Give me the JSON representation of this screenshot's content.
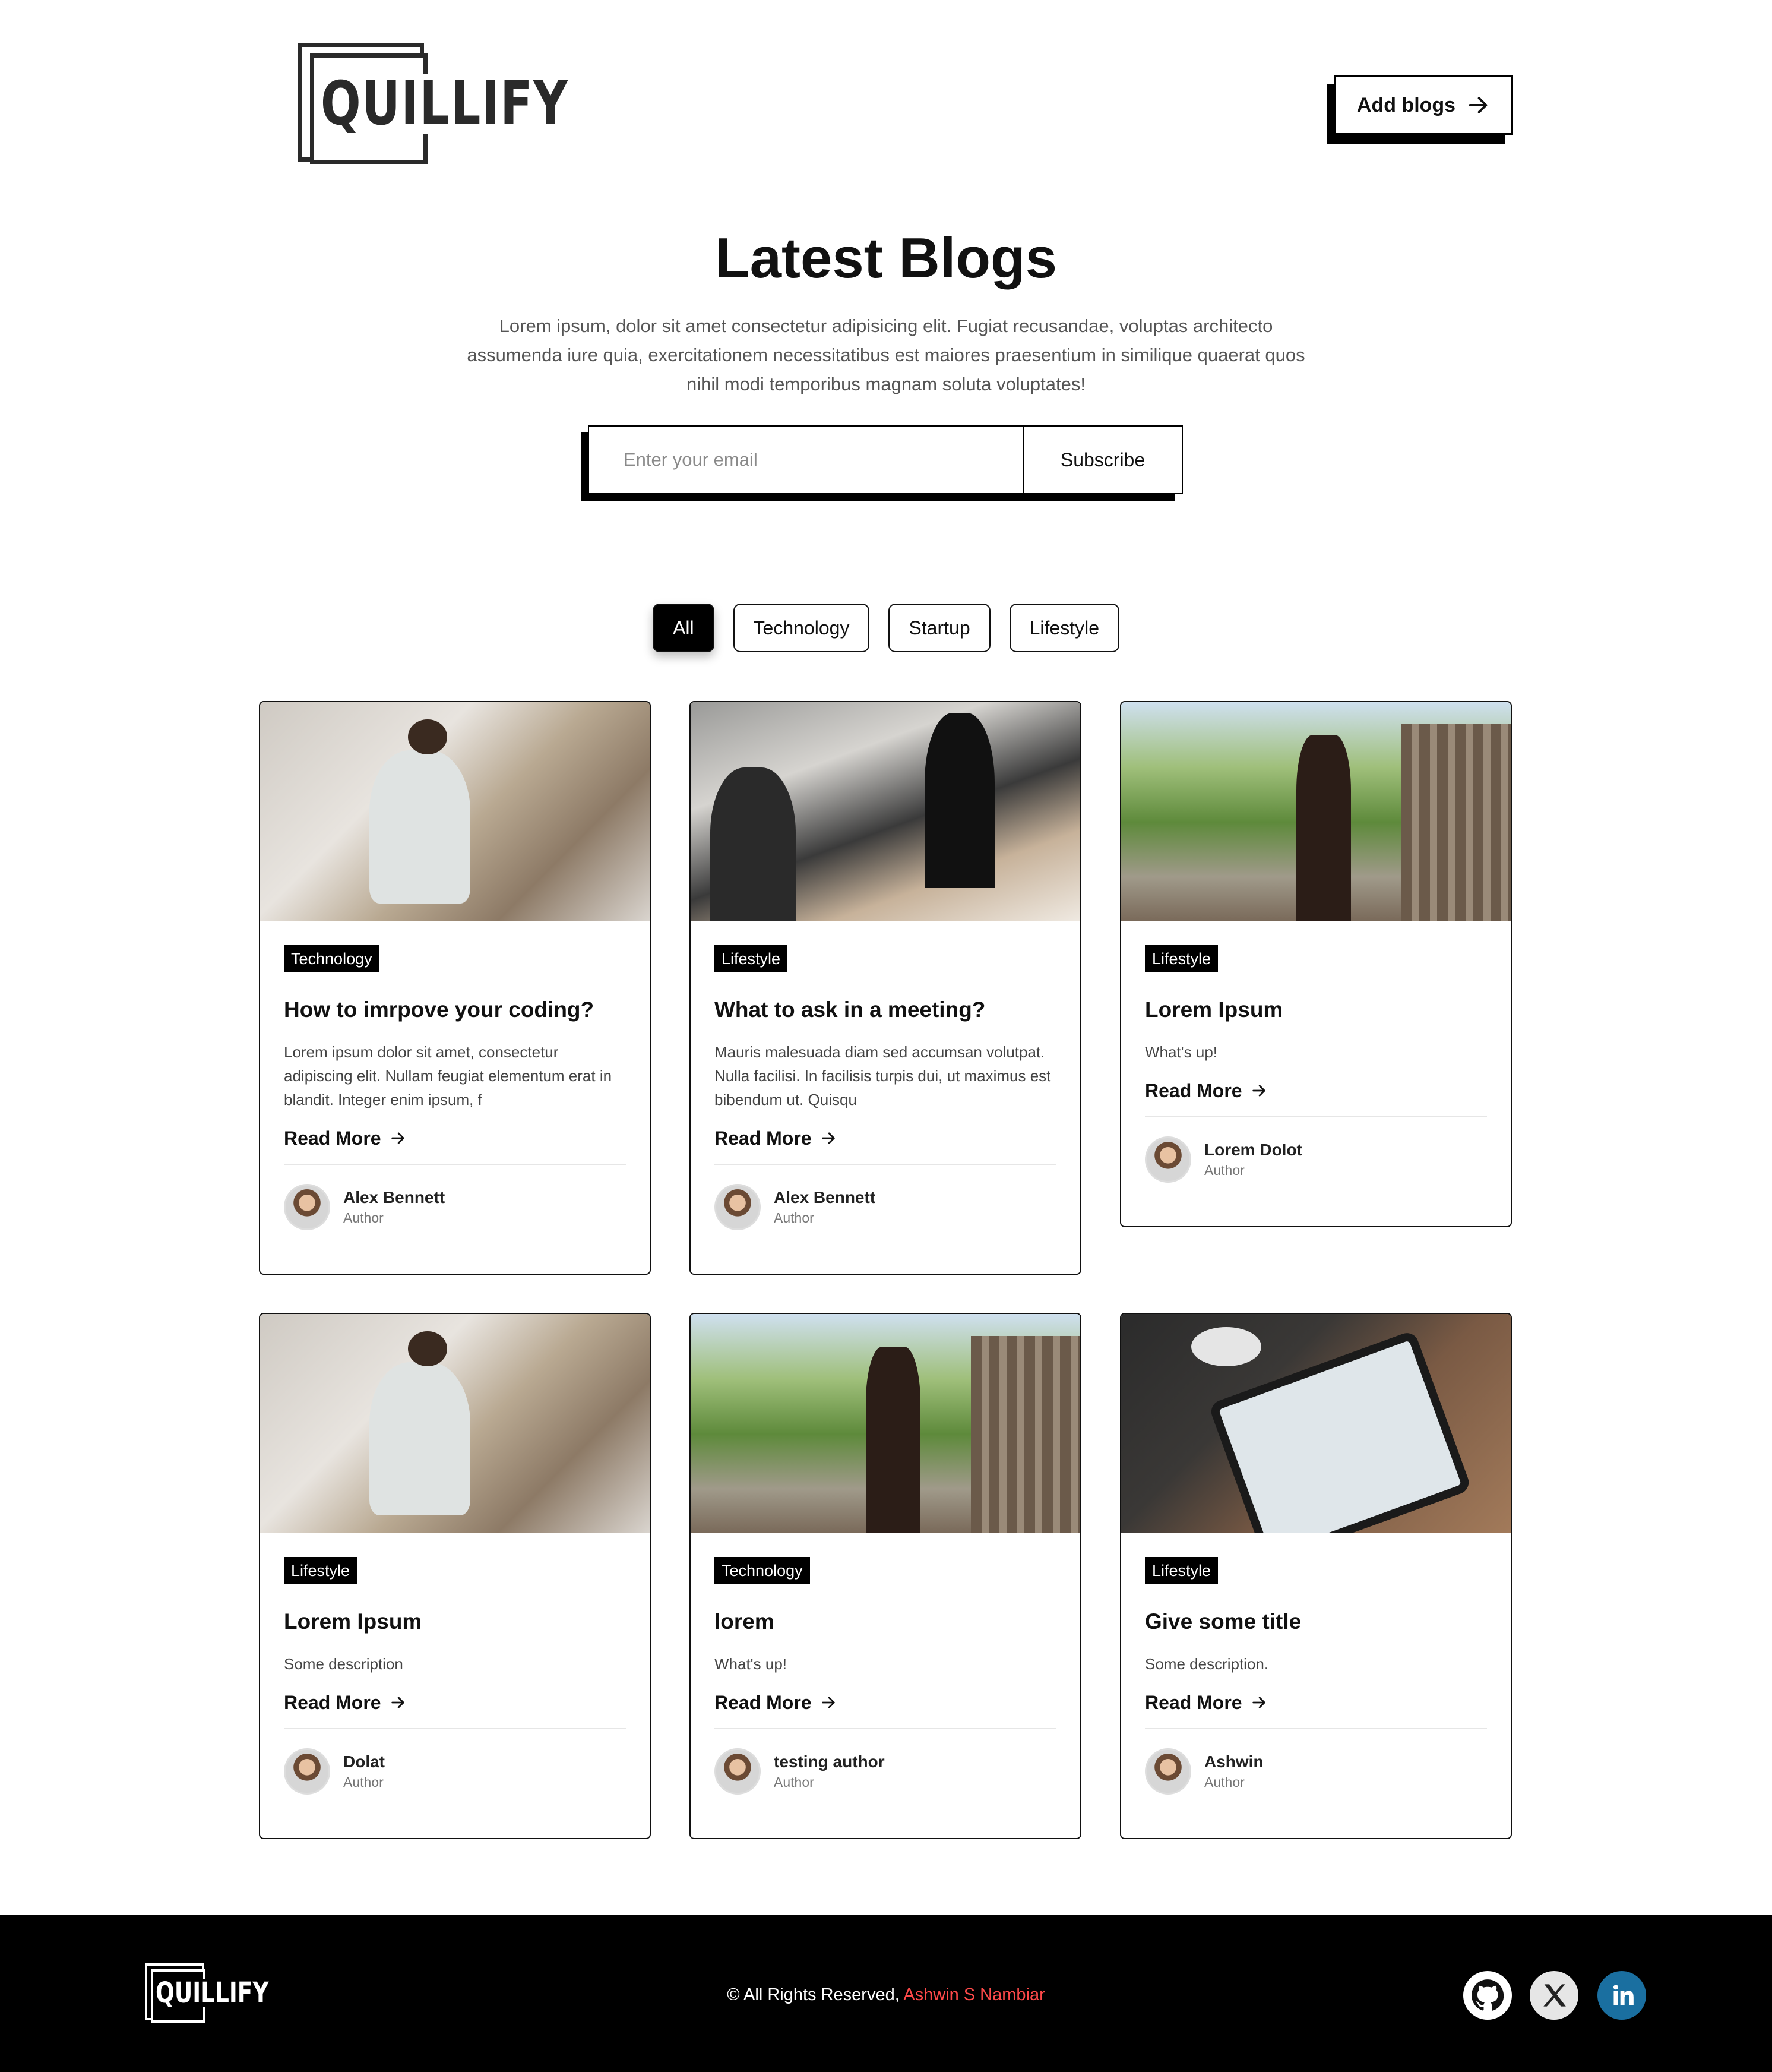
{
  "brand": {
    "name": "QUILLIFY"
  },
  "header": {
    "add_blogs_label": "Add blogs"
  },
  "hero": {
    "title": "Latest Blogs",
    "description": "Lorem ipsum, dolor sit amet consectetur adipisicing elit. Fugiat recusandae, voluptas architecto assumenda iure quia, exercitationem necessitatibus est maiores praesentium in similique quaerat quos nihil modi temporibus magnam soluta voluptates!"
  },
  "subscribe": {
    "placeholder": "Enter your email",
    "button_label": "Subscribe"
  },
  "filters": {
    "items": [
      "All",
      "Technology",
      "Startup",
      "Lifestyle"
    ],
    "active": "All"
  },
  "read_more_label": "Read More",
  "author_role_label": "Author",
  "cards": [
    {
      "category": "Technology",
      "title": "How to imrpove your coding?",
      "description": "Lorem ipsum dolor sit amet, consectetur adipiscing elit. Nullam feugiat elementum erat in blandit. Integer enim ipsum, f",
      "author": "Alex Bennett",
      "image": "office-laptop-photo"
    },
    {
      "category": "Lifestyle",
      "title": "What to ask in a meeting?",
      "description": "Mauris malesuada diam sed accumsan volutpat. Nulla facilisi. In facilisis turpis dui, ut maximus est bibendum ut. Quisqu",
      "author": "Alex Bennett",
      "image": "meeting-photo"
    },
    {
      "category": "Lifestyle",
      "title": "Lorem Ipsum",
      "description": "What's up!",
      "author": "Lorem Dolot",
      "image": "family-horse-photo"
    },
    {
      "category": "Lifestyle",
      "title": "Lorem Ipsum",
      "description": "Some description",
      "author": "Dolat",
      "image": "office-laptop-photo"
    },
    {
      "category": "Technology",
      "title": "lorem",
      "description": "What's up!",
      "author": "testing author",
      "image": "family-horse-photo"
    },
    {
      "category": "Lifestyle",
      "title": "Give some title",
      "description": "Some description.",
      "author": "Ashwin",
      "image": "tablet-sketch-photo"
    }
  ],
  "footer": {
    "copyright_prefix": "© All Rights Reserved, ",
    "copyright_name": "Ashwin S Nambiar",
    "copyright_name_color": "#ff4a4a",
    "social": [
      "github-icon",
      "x-icon",
      "linkedin-icon"
    ],
    "linkedin_color": "#1a6fa0"
  }
}
